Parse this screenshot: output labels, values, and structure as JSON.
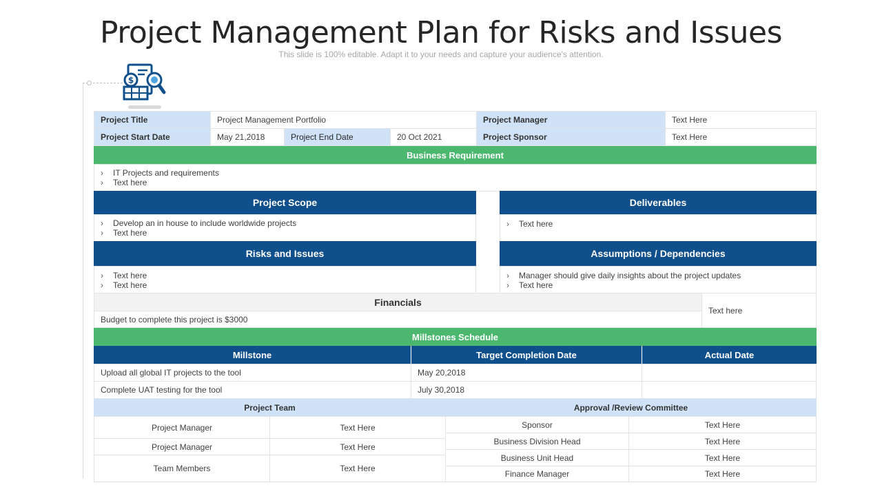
{
  "header": {
    "title": "Project Management Plan for Risks and Issues",
    "subtitle": "This slide is 100% editable. Adapt it to your needs and capture your audience's attention.",
    "icon": "finance-document-search-icon"
  },
  "colors": {
    "green": "#4cb86f",
    "blue": "#0f4f8c",
    "light_blue": "#cfe2f7",
    "gray": "#f2f2f2"
  },
  "info": {
    "project_title_label": "Project Title",
    "project_title_value": "Project Management Portfolio",
    "project_manager_label": "Project Manager",
    "project_manager_value": "Text Here",
    "start_date_label": "Project Start Date",
    "start_date_value": "May 21,2018",
    "end_date_label": "Project End Date",
    "end_date_value": "20 Oct 2021",
    "sponsor_label": "Project  Sponsor",
    "sponsor_value": "Text Here"
  },
  "business_requirement": {
    "heading": "Business Requirement",
    "items": [
      "IT Projects and requirements",
      "Text here"
    ]
  },
  "project_scope": {
    "heading": "Project Scope",
    "items": [
      "Develop an in house to include worldwide projects",
      "Text here"
    ]
  },
  "deliverables": {
    "heading": "Deliverables",
    "items": [
      "Text here"
    ]
  },
  "risks_issues": {
    "heading": "Risks and Issues",
    "items": [
      "Text here",
      "Text here"
    ]
  },
  "assumptions": {
    "heading": "Assumptions / Dependencies",
    "items": [
      "Manager should give daily insights about the project updates",
      "Text here"
    ]
  },
  "financials": {
    "heading": "Financials",
    "budget": "Budget to complete this project is $3000",
    "side_text": "Text here"
  },
  "milestones": {
    "heading": "Millstones  Schedule",
    "columns": [
      "Millstone",
      "Target Completion Date",
      "Actual Date"
    ],
    "rows": [
      [
        "Upload all global IT projects to the tool",
        "May 20,2018",
        ""
      ],
      [
        "Complete UAT testing for the tool",
        "July 30,2018",
        ""
      ]
    ]
  },
  "team": {
    "heading": "Project Team",
    "rows": [
      [
        "Project Manager",
        "Text Here"
      ],
      [
        "Project Manager",
        "Text Here"
      ],
      [
        "Team Members",
        "Text Here"
      ]
    ]
  },
  "committee": {
    "heading": "Approval /Review Committee",
    "rows": [
      [
        "Sponsor",
        "Text Here"
      ],
      [
        "Business Division Head",
        "Text Here"
      ],
      [
        "Business Unit Head",
        "Text Here"
      ],
      [
        "Finance Manager",
        "Text Here"
      ]
    ]
  },
  "bullet_char": "›"
}
